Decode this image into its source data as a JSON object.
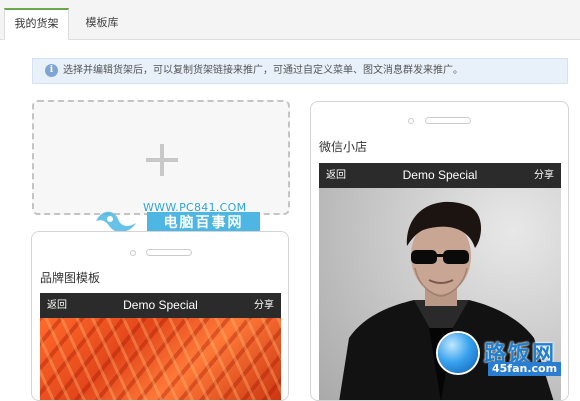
{
  "tabs": [
    {
      "label": "我的货架",
      "active": true
    },
    {
      "label": "模板库",
      "active": false
    }
  ],
  "notice": {
    "icon": "info-icon",
    "text": "选择并编辑货架后，可以复制货架链接来推广，可通过自定义菜单、图文消息群发来推广。"
  },
  "add_box": {
    "icon": "plus-icon"
  },
  "watermark": {
    "url": "WWW.PC841.COM",
    "name": "电脑百事网"
  },
  "templates": [
    {
      "title": "品牌图模板",
      "bar": {
        "back": "返回",
        "title": "Demo Special",
        "share": "分享"
      },
      "image": "orange-petals-image"
    },
    {
      "title": "微信小店",
      "bar": {
        "back": "返回",
        "title": "Demo Special",
        "share": "分享"
      },
      "image": "man-sunglasses-photo"
    }
  ],
  "site_logo": {
    "name": "路饭网",
    "url": "45fan.com"
  },
  "colors": {
    "active_tab_accent": "#6aa84f",
    "notice_bg": "#e8f0f9",
    "app_bar_bg": "#2b2b2b",
    "watermark_blue": "#4db6e2"
  }
}
